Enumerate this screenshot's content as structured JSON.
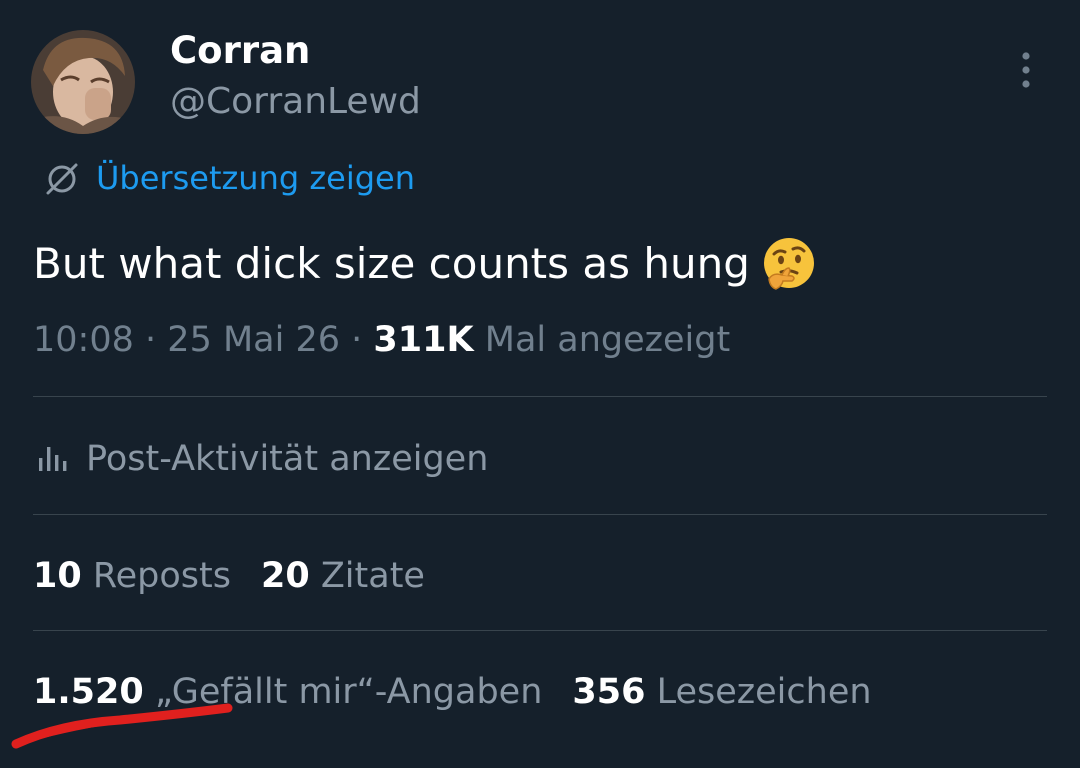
{
  "author": {
    "display_name": "Corran",
    "handle": "@CorranLewd"
  },
  "translate_label": "Übersetzung zeigen",
  "tweet": {
    "text": "But what dick size counts as hung",
    "emoji": "thinking-face"
  },
  "meta": {
    "time": "10:08",
    "separator": "·",
    "date": "25 Mai 26",
    "views_count": "311K",
    "views_label": "Mal angezeigt"
  },
  "activity_label": "Post-Aktivität anzeigen",
  "stats": {
    "reposts_count": "10",
    "reposts_label": "Reposts",
    "quotes_count": "20",
    "quotes_label": "Zitate",
    "likes_count": "1.520",
    "likes_label": "„Gefällt mir“-Angaben",
    "bookmarks_count": "356",
    "bookmarks_label": "Lesezeichen"
  },
  "colors": {
    "background": "#15202b",
    "link": "#1d9bf0",
    "secondary_text": "#8b98a5",
    "divider": "#38444d",
    "annotation": "#e0201e"
  },
  "icons": {
    "menu": "more-vertical-icon",
    "translate": "globe-slash-icon",
    "activity": "bar-chart-icon"
  }
}
